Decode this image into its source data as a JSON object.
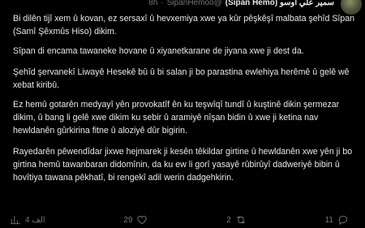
{
  "header": {
    "time": "8h",
    "handle": "SipanHemoo@",
    "name": "(Sîpan Hemo) سمير علي آوسو"
  },
  "tweet": {
    "paragraphs": [
      "Bi dilên tijî xem û kovan, ez sersaxî û hevxemiya xwe ya kûr pêşkêşî malbata şehîd Sîpan (Samî Şêxmûs Hiso) dikim.",
      "Sîpan di encama tawaneke hovane û xiyanetkarane de jiyana xwe ji dest da.",
      "Şehîd şervanekî Liwayê Hesekê bû û bi salan ji bo parastina ewlehiya herêmê û gelê wê xebat kiribû.",
      "Ez hemû gotarên medyayî yên provokatîf ên ku teşwîqî tundî û kuştinê dikin şermezar dikim, û bang li gelê xwe dikim ku sebir û aramiyê nîşan bidin û xwe ji ketina nav hewldanên gûrkirina fitne û aloziyê dûr bigirin.",
      "Rayedarên pêwendîdar jixwe hejmarek ji kesên têkildar girtine û hewldanên xwe yên ji bo girtina hemû tawanbaran didomînin, da ku ew li gorî yasayê rûbirûyî dadweriyê bibin û hovîtiya tawana pêkhatî, bi rengekî adil werin dadgehkirin."
    ]
  },
  "actions": {
    "views": "4 الف",
    "likes": "29",
    "retweets": "2",
    "replies": "11"
  },
  "icons": [
    "chart-icon",
    "heart-icon",
    "retweet-icon",
    "reply-icon"
  ]
}
